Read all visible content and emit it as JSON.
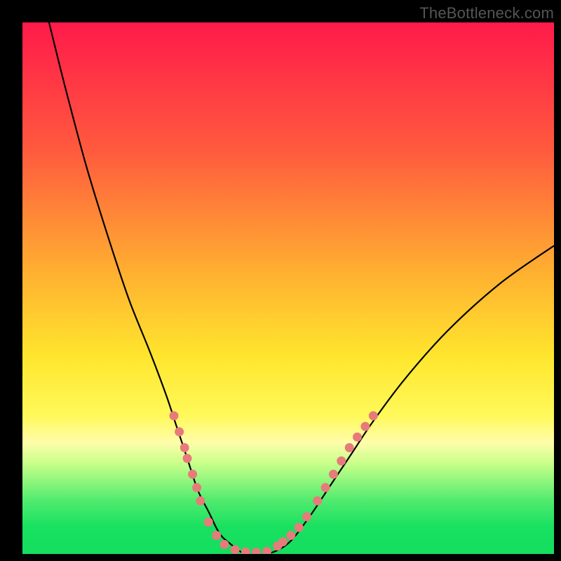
{
  "watermark": "TheBottleneck.com",
  "chart_data": {
    "type": "line",
    "title": "",
    "xlabel": "",
    "ylabel": "",
    "xlim": [
      0,
      100
    ],
    "ylim": [
      0,
      100
    ],
    "series": [
      {
        "name": "curve",
        "x": [
          5,
          8,
          12,
          16,
          20,
          24,
          27,
          29,
          31,
          33,
          35,
          37,
          39,
          42,
          46,
          50,
          54,
          58,
          62,
          66,
          72,
          80,
          90,
          100
        ],
        "y": [
          100,
          88,
          73,
          60,
          48,
          38,
          30,
          24,
          18,
          12,
          8,
          4,
          2,
          0,
          0,
          2,
          7,
          13,
          19,
          25,
          33,
          42,
          51,
          58
        ]
      }
    ],
    "markers": [
      {
        "x": 28.5,
        "y": 26
      },
      {
        "x": 29.5,
        "y": 23
      },
      {
        "x": 30.5,
        "y": 20
      },
      {
        "x": 31.0,
        "y": 18
      },
      {
        "x": 32.0,
        "y": 15
      },
      {
        "x": 32.8,
        "y": 12.5
      },
      {
        "x": 33.5,
        "y": 10
      },
      {
        "x": 35.0,
        "y": 6
      },
      {
        "x": 36.5,
        "y": 3.5
      },
      {
        "x": 38.0,
        "y": 1.8
      },
      {
        "x": 40.0,
        "y": 0.8
      },
      {
        "x": 42.0,
        "y": 0.4
      },
      {
        "x": 44.0,
        "y": 0.3
      },
      {
        "x": 46.0,
        "y": 0.5
      },
      {
        "x": 48.0,
        "y": 1.5
      },
      {
        "x": 49.0,
        "y": 2.3
      },
      {
        "x": 50.5,
        "y": 3.5
      },
      {
        "x": 52.0,
        "y": 5
      },
      {
        "x": 53.5,
        "y": 7
      },
      {
        "x": 55.5,
        "y": 10
      },
      {
        "x": 57.0,
        "y": 12.5
      },
      {
        "x": 58.5,
        "y": 15
      },
      {
        "x": 60.0,
        "y": 17.5
      },
      {
        "x": 61.5,
        "y": 20
      },
      {
        "x": 63.0,
        "y": 22
      },
      {
        "x": 64.5,
        "y": 24
      },
      {
        "x": 66.0,
        "y": 26
      }
    ],
    "gradient_stops": [
      {
        "pos": 0,
        "color": "#ff1a4a"
      },
      {
        "pos": 24,
        "color": "#ff5a3e"
      },
      {
        "pos": 48,
        "color": "#ffb330"
      },
      {
        "pos": 63,
        "color": "#ffe62e"
      },
      {
        "pos": 74,
        "color": "#fff95a"
      },
      {
        "pos": 79,
        "color": "#fffdaa"
      },
      {
        "pos": 83,
        "color": "#c8ff8a"
      },
      {
        "pos": 90,
        "color": "#4feb6e"
      },
      {
        "pos": 95,
        "color": "#18e060"
      },
      {
        "pos": 100,
        "color": "#15dd5e"
      }
    ],
    "marker_color": "#e77b7b",
    "curve_color": "#000000"
  }
}
